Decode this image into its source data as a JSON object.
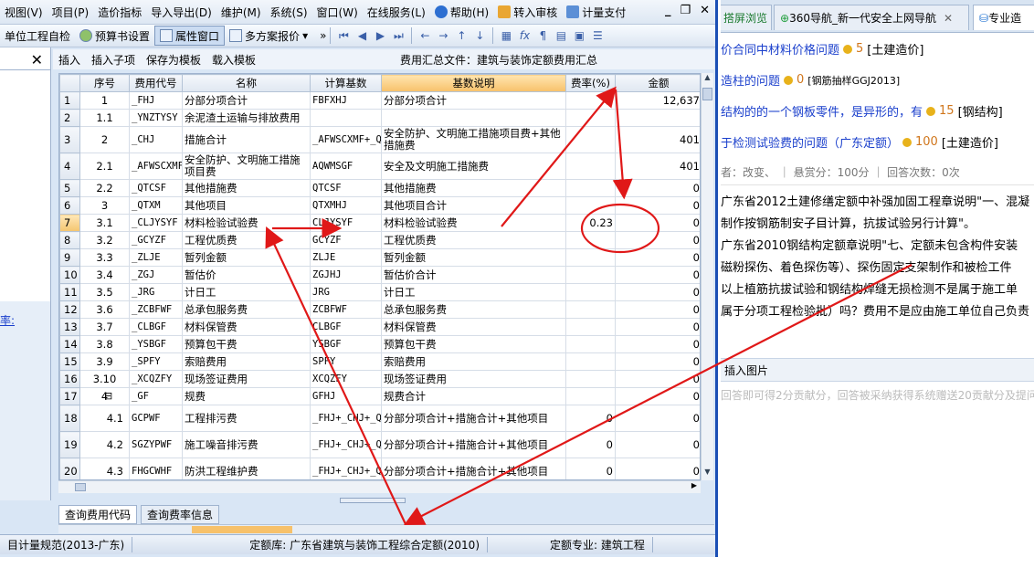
{
  "menu": {
    "items": [
      "视图(V)",
      "项目(P)",
      "造价指标",
      "导入导出(D)",
      "维护(M)",
      "系统(S)",
      "窗口(W)",
      "在线服务(L)",
      "帮助(H)",
      "转入审核",
      "计量支付"
    ]
  },
  "toolbar": {
    "unit_check": "单位工程自检",
    "budget_settings": "预算书设置",
    "property_window": "属性窗口",
    "multi_plan": "多方案报价"
  },
  "subbar": {
    "insert": "插入",
    "insert_child": "插入子项",
    "save_template": "保存为模板",
    "load_template": "载入模板",
    "file_label": "费用汇总文件：建筑与装饰定额费用汇总"
  },
  "left_link": "率:",
  "table": {
    "headers": [
      "",
      "序号",
      "费用代号",
      "名称",
      "计算基数",
      "基数说明",
      "费率(%)",
      "金额"
    ],
    "rows": [
      [
        "1",
        "1",
        "_FHJ",
        "分部分项合计",
        "FBFXHJ",
        "分部分项合计",
        "",
        "12,637"
      ],
      [
        "2",
        "1.1",
        "_YNZTYSY",
        "余泥渣土运输与排放费用",
        "",
        "",
        "",
        ""
      ],
      [
        "3",
        "2",
        "_CHJ",
        "措施合计",
        "_AFWSCXMF+_QTCSF",
        "安全防护、文明施工措施项目费+其他措施费",
        "",
        "401"
      ],
      [
        "4",
        "2.1",
        "_AFWSCXMF",
        "安全防护、文明施工措施项目费",
        "AQWMSGF",
        "安全及文明施工措施费",
        "",
        "401"
      ],
      [
        "5",
        "2.2",
        "_QTCSF",
        "其他措施费",
        "QTCSF",
        "其他措施费",
        "",
        "0"
      ],
      [
        "6",
        "3",
        "_QTXM",
        "其他项目",
        "QTXMHJ",
        "其他项目合计",
        "",
        "0"
      ],
      [
        "7",
        "3.1",
        "_CLJYSYF",
        "材料检验试验费",
        "CLJYSYF",
        "材料检验试验费",
        "0.23",
        "0"
      ],
      [
        "8",
        "3.2",
        "_GCYZF",
        "工程优质费",
        "GCYZF",
        "工程优质费",
        "",
        "0"
      ],
      [
        "9",
        "3.3",
        "_ZLJE",
        "暂列金额",
        "ZLJE",
        "暂列金额",
        "",
        "0"
      ],
      [
        "10",
        "3.4",
        "_ZGJ",
        "暂估价",
        "ZGJHJ",
        "暂估价合计",
        "",
        "0"
      ],
      [
        "11",
        "3.5",
        "_JRG",
        "计日工",
        "JRG",
        "计日工",
        "",
        "0"
      ],
      [
        "12",
        "3.6",
        "_ZCBFWF",
        "总承包服务费",
        "ZCBFWF",
        "总承包服务费",
        "",
        "0"
      ],
      [
        "13",
        "3.7",
        "_CLBGF",
        "材料保管费",
        "CLBGF",
        "材料保管费",
        "",
        "0"
      ],
      [
        "14",
        "3.8",
        "_YSBGF",
        "预算包干费",
        "YSBGF",
        "预算包干费",
        "",
        "0"
      ],
      [
        "15",
        "3.9",
        "_SPFY",
        "索赔费用",
        "SPFY",
        "索赔费用",
        "",
        "0"
      ],
      [
        "16",
        "3.10",
        "_XCQZFY",
        "现场签证费用",
        "XCQZFY",
        "现场签证费用",
        "",
        "0"
      ],
      [
        "17",
        "4",
        "_GF",
        "规费",
        "GFHJ",
        "规费合计",
        "",
        "0"
      ],
      [
        "18",
        "4.1",
        "GCPWF",
        "工程排污费",
        "_FHJ+_CHJ+_QTXM",
        "分部分项合计+措施合计+其他项目",
        "0",
        "0"
      ],
      [
        "19",
        "4.2",
        "SGZYPWF",
        "施工噪音排污费",
        "_FHJ+_CHJ+_QTXM",
        "分部分项合计+措施合计+其他项目",
        "0",
        "0"
      ],
      [
        "20",
        "4.3",
        "FHGCWHF",
        "防洪工程维护费",
        "_FHJ+_CHJ+_QTXM",
        "分部分项合计+措施合计+其他项目",
        "0",
        "0"
      ]
    ]
  },
  "bottom_tabs": [
    "查询费用代码",
    "查询费率信息"
  ],
  "status": {
    "spec": "目计量规范(2013-广东)",
    "quota_lib": "定额库: 广东省建筑与装饰工程综合定额(2010)",
    "quota_major": "定额专业: 建筑工程"
  },
  "browser": {
    "tabs": [
      "搭屏浏览",
      "360导航_新一代安全上网导航",
      "专业造"
    ],
    "questions": [
      {
        "title": "价合同中材料价格问题",
        "points": "5",
        "tag": "[土建造价]"
      },
      {
        "title": "造柱的问题",
        "points": "0",
        "tag": "[钢筋抽样GGJ2013]"
      },
      {
        "title": "结构的的一个钢板零件，是异形的，有",
        "points": "15",
        "tag": "[钢结构]"
      },
      {
        "title": "于检测试验费的问题（广东定额）",
        "points": "100",
        "tag": "[土建造价]"
      }
    ],
    "meta": "者：改变、   ｜  悬赏分：100分  ｜  回答次数：0次",
    "body_lines": [
      "广东省2012土建修缮定额中补强加固工程章说明\"一、混凝",
      "制作按钢筋制安子目计算，抗拔试验另行计算\"。",
      "广东省2010钢结构定额章说明\"七、定额未包含构件安装",
      "磁粉探伤、着色探伤等）、探伤固定支架制作和被检工件",
      "以上植筋抗拔试验和钢结构焊缝无损检测不是属于施工单",
      "属于分项工程检验批）吗？费用不是应由施工单位自己负责"
    ],
    "insert_image": "插入图片",
    "hint": "回答即可得2分贡献分，回答被采纳获得系统赠送20贡献分及提问者"
  }
}
